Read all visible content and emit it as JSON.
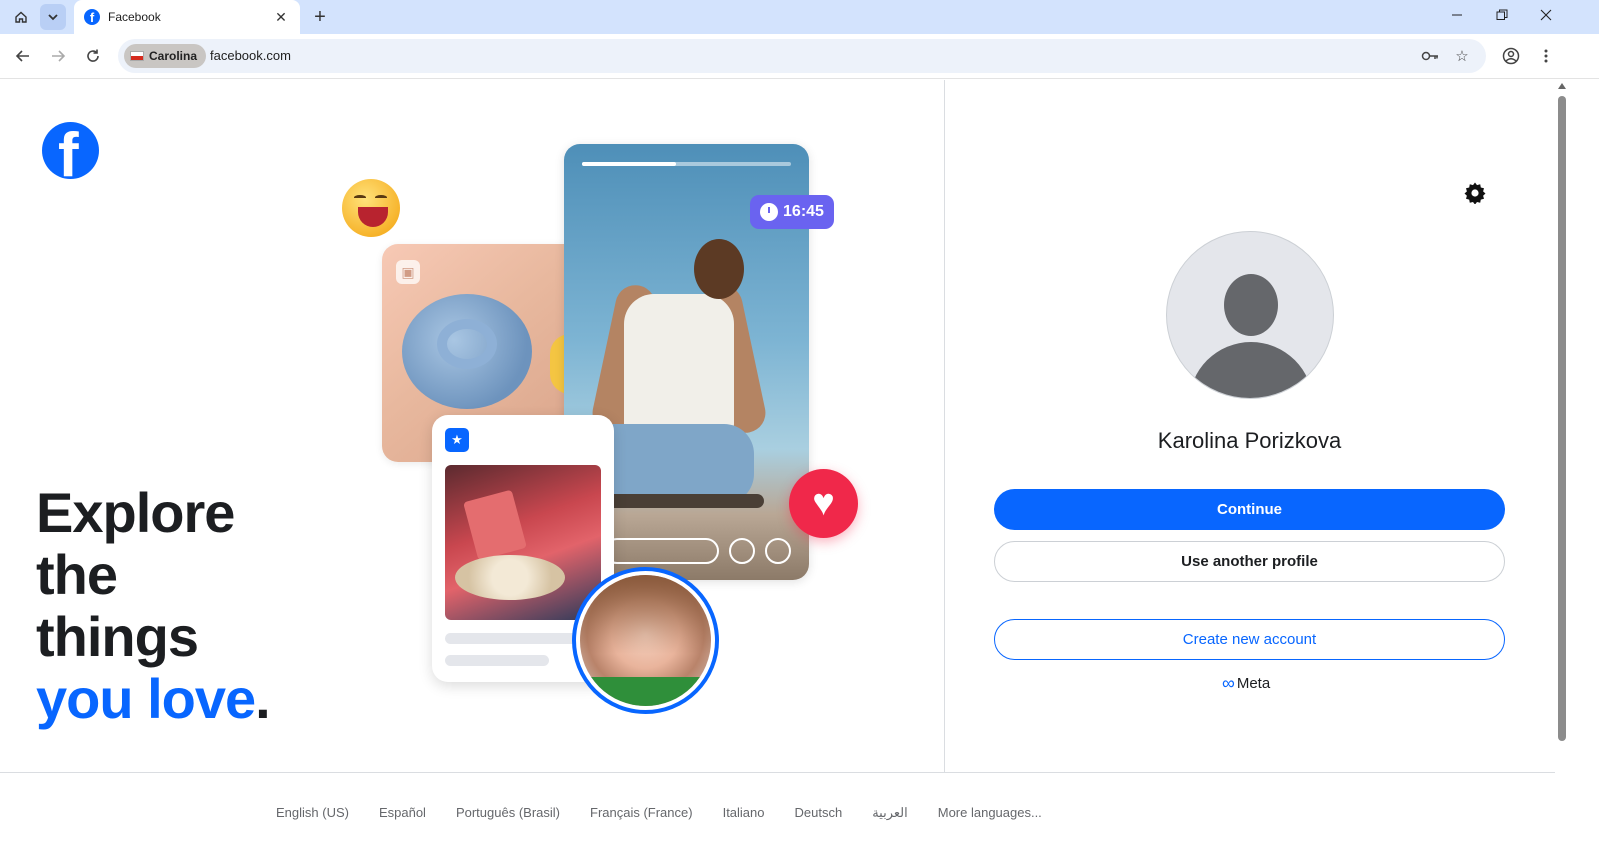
{
  "browser": {
    "tab": {
      "title": "Facebook",
      "favicon": "facebook-icon"
    },
    "profile_chip": "Carolina",
    "url": "facebook.com",
    "icons": [
      "home-icon",
      "tab-search-icon",
      "close-icon",
      "plus-icon",
      "minimize-icon",
      "restore-icon",
      "close-window-icon",
      "back-icon",
      "forward-icon",
      "reload-icon",
      "key-icon",
      "star-icon",
      "account-icon",
      "more-icon"
    ]
  },
  "page": {
    "logo": "facebook-logo",
    "hero": {
      "line1": "Explore",
      "line2": "the",
      "line3": "things",
      "line4_blue": "you love",
      "line4_dot": "."
    },
    "illustration": {
      "time_badge": "16:45",
      "story_progress": 0.45
    },
    "account": {
      "name": "Karolina Porizkova",
      "continue_label": "Continue",
      "other_profile_label": "Use another profile",
      "create_label": "Create new account",
      "meta_label": "Meta"
    },
    "footer": {
      "languages": [
        "English (US)",
        "Español",
        "Português (Brasil)",
        "Français (France)",
        "Italiano",
        "Deutsch",
        "العربية",
        "More languages..."
      ]
    }
  },
  "colors": {
    "brand": "#0866ff",
    "chrome_tabbar": "#d3e3fd",
    "text": "#1c1e21",
    "muted": "#65676b"
  }
}
